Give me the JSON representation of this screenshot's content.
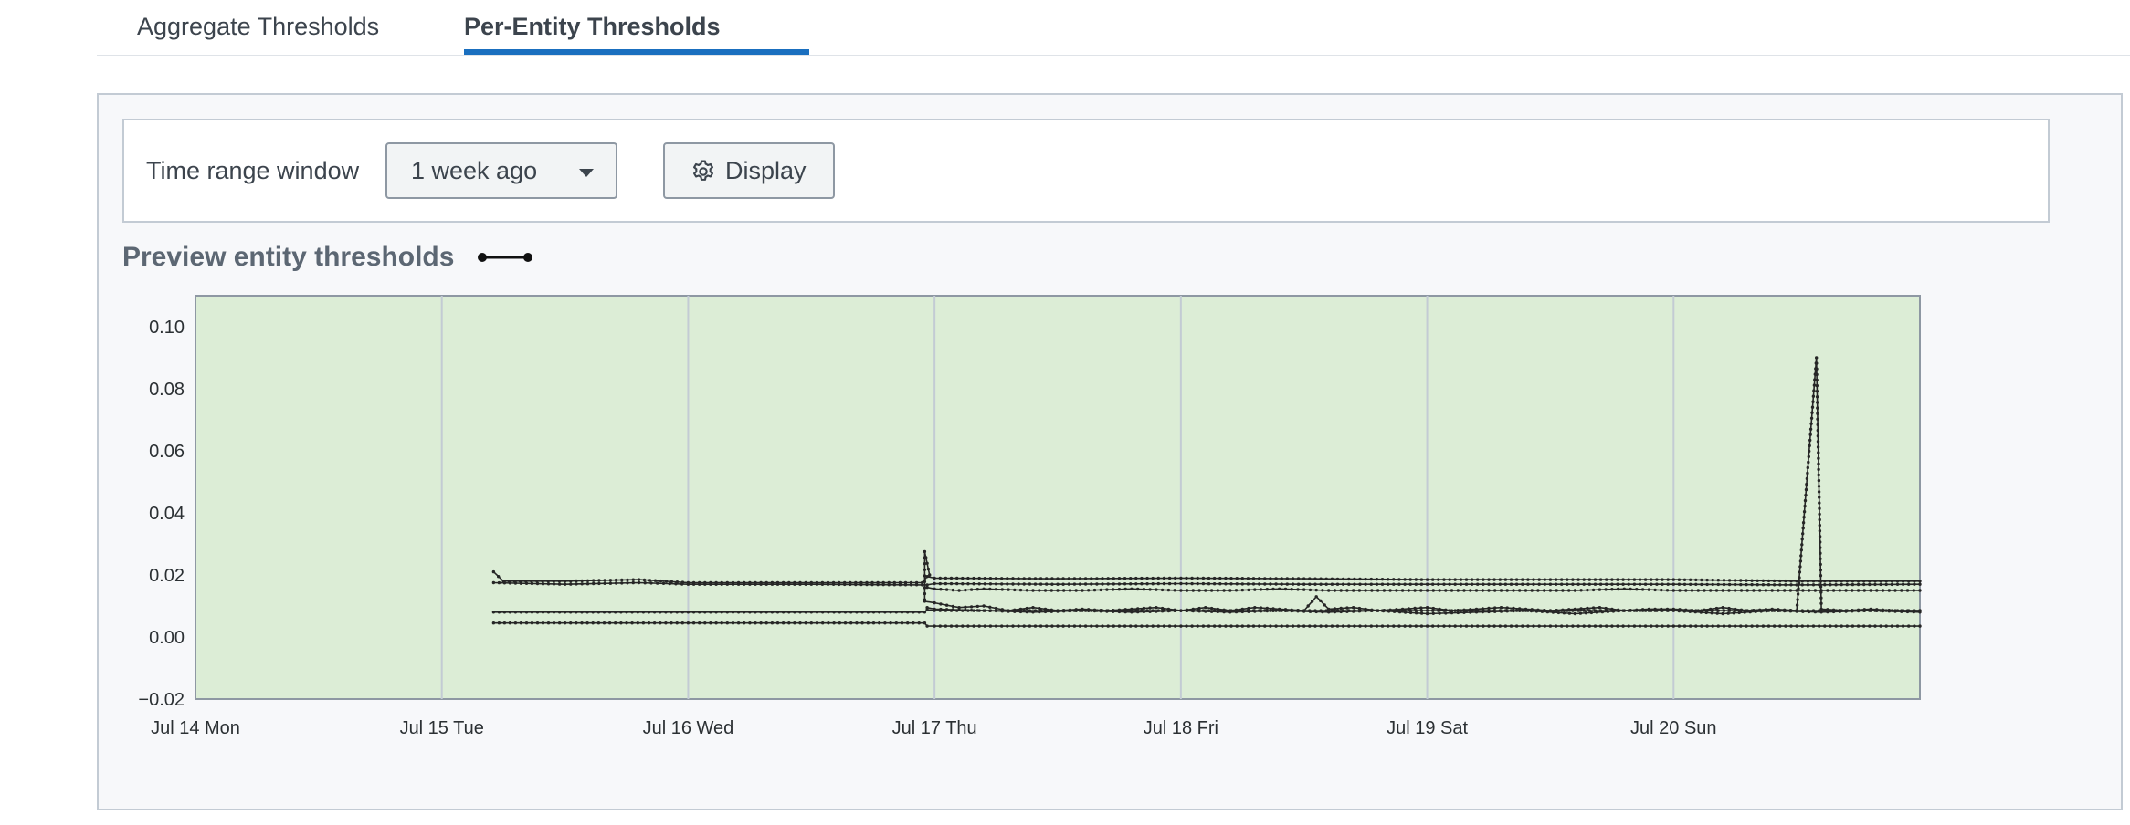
{
  "tabs": [
    {
      "label": "Aggregate Thresholds",
      "selected": false
    },
    {
      "label": "Per-Entity Thresholds",
      "selected": true
    }
  ],
  "toolbar": {
    "time_range_label": "Time range window",
    "time_range_value": "1 week ago",
    "display_label": "Display"
  },
  "preview": {
    "title": "Preview entity thresholds"
  },
  "colors": {
    "accent": "#1a6fbf",
    "plot_background": "#dcedd6",
    "series": "#262626",
    "gridline": "#c3cbd4"
  },
  "chart_data": {
    "type": "line",
    "title": "",
    "xlabel": "",
    "ylabel": "",
    "xlim": [
      0,
      7
    ],
    "ylim": [
      -0.02,
      0.11
    ],
    "x_ticks": [
      {
        "pos": 0,
        "label": "Jul 14 Mon"
      },
      {
        "pos": 1,
        "label": "Jul 15 Tue"
      },
      {
        "pos": 2,
        "label": "Jul 16 Wed"
      },
      {
        "pos": 3,
        "label": "Jul 17 Thu"
      },
      {
        "pos": 4,
        "label": "Jul 18 Fri"
      },
      {
        "pos": 5,
        "label": "Jul 19 Sat"
      },
      {
        "pos": 6,
        "label": "Jul 20 Sun"
      }
    ],
    "y_ticks": [
      {
        "value": 0.1,
        "label": "0.10"
      },
      {
        "value": 0.08,
        "label": "0.08"
      },
      {
        "value": 0.06,
        "label": "0.06"
      },
      {
        "value": 0.04,
        "label": "0.04"
      },
      {
        "value": 0.02,
        "label": "0.02"
      },
      {
        "value": 0.0,
        "label": "0.00"
      },
      {
        "value": -0.02,
        "label": "−0.02"
      }
    ],
    "grid": "vertical",
    "series": [
      {
        "x": [
          1.21,
          1.25,
          1.5,
          1.8,
          2.0,
          2.5,
          2.95,
          2.97,
          3.0,
          3.5,
          4.0,
          4.5,
          5.0,
          5.5,
          6.0,
          6.5,
          7.0
        ],
        "y": [
          0.021,
          0.018,
          0.018,
          0.0185,
          0.0175,
          0.0175,
          0.0175,
          0.0195,
          0.019,
          0.0188,
          0.019,
          0.0188,
          0.0185,
          0.0185,
          0.0185,
          0.018,
          0.018
        ]
      },
      {
        "x": [
          1.21,
          1.5,
          1.8,
          2.0,
          2.5,
          2.95,
          2.97,
          3.0,
          3.5,
          4.0,
          4.5,
          5.0,
          5.5,
          6.0,
          6.5,
          7.0
        ],
        "y": [
          0.0175,
          0.017,
          0.0175,
          0.017,
          0.017,
          0.0168,
          0.0168,
          0.0172,
          0.017,
          0.0172,
          0.017,
          0.017,
          0.017,
          0.017,
          0.0168,
          0.017
        ]
      },
      {
        "x": [
          2.97,
          3.0,
          3.1,
          3.2,
          3.4,
          3.6,
          3.8,
          4.0,
          4.2,
          4.4,
          4.6,
          4.8,
          5.0,
          5.2,
          5.4,
          5.6,
          5.8,
          6.0,
          6.2,
          6.4,
          6.6,
          6.8,
          7.0
        ],
        "y": [
          0.016,
          0.0155,
          0.015,
          0.0155,
          0.015,
          0.015,
          0.0155,
          0.015,
          0.015,
          0.0155,
          0.015,
          0.015,
          0.015,
          0.015,
          0.015,
          0.015,
          0.0155,
          0.015,
          0.015,
          0.015,
          0.015,
          0.015,
          0.015
        ]
      },
      {
        "x": [
          2.96,
          3.0,
          3.1,
          3.2,
          3.3,
          3.4,
          3.5,
          3.6,
          3.7,
          3.8,
          3.9,
          4.0,
          4.1,
          4.2,
          4.3,
          4.4,
          4.5,
          4.55,
          4.6,
          4.7,
          4.8,
          4.9,
          5.0,
          5.1,
          5.2,
          5.3,
          5.4,
          5.5,
          5.6,
          5.7,
          5.8,
          5.9,
          6.0,
          6.1,
          6.2,
          6.3,
          6.4,
          6.5,
          6.58,
          6.6,
          6.7,
          6.8,
          6.9,
          7.0
        ],
        "y": [
          0.0115,
          0.011,
          0.0095,
          0.01,
          0.0085,
          0.0095,
          0.0085,
          0.009,
          0.0085,
          0.009,
          0.0095,
          0.0085,
          0.0095,
          0.0085,
          0.0095,
          0.009,
          0.0085,
          0.013,
          0.009,
          0.0095,
          0.0085,
          0.009,
          0.0095,
          0.0085,
          0.009,
          0.0095,
          0.009,
          0.0085,
          0.009,
          0.0095,
          0.0085,
          0.009,
          0.009,
          0.0085,
          0.0095,
          0.0085,
          0.009,
          0.0085,
          0.09,
          0.009,
          0.0085,
          0.009,
          0.0085,
          0.0085
        ]
      },
      {
        "x": [
          2.97,
          3.0,
          3.2,
          3.4,
          3.6,
          3.8,
          4.0,
          4.2,
          4.4,
          4.6,
          4.8,
          5.0,
          5.2,
          5.4,
          5.6,
          5.8,
          6.0,
          6.2,
          6.4,
          6.6,
          6.8,
          7.0
        ],
        "y": [
          0.0095,
          0.009,
          0.0085,
          0.008,
          0.0085,
          0.008,
          0.0085,
          0.008,
          0.0085,
          0.008,
          0.0085,
          0.0075,
          0.008,
          0.0085,
          0.0075,
          0.0085,
          0.0085,
          0.0075,
          0.0085,
          0.008,
          0.0085,
          0.008
        ]
      },
      {
        "x": [
          1.21,
          1.5,
          2.0,
          2.5,
          2.96,
          2.97,
          3.0,
          3.5,
          4.0,
          4.5,
          5.0,
          5.5,
          6.0,
          6.5,
          7.0
        ],
        "y": [
          0.008,
          0.008,
          0.008,
          0.008,
          0.008,
          0.0088,
          0.0085,
          0.0085,
          0.0085,
          0.0085,
          0.0085,
          0.0085,
          0.0085,
          0.0085,
          0.0085
        ]
      },
      {
        "x": [
          1.21,
          1.5,
          2.0,
          2.5,
          2.96,
          2.97,
          3.0,
          3.5,
          4.0,
          4.5,
          5.0,
          5.5,
          6.0,
          6.5,
          7.0
        ],
        "y": [
          0.0045,
          0.0045,
          0.0045,
          0.0045,
          0.0045,
          0.0035,
          0.0035,
          0.0035,
          0.0035,
          0.0035,
          0.0035,
          0.0035,
          0.0035,
          0.0035,
          0.0035
        ]
      },
      {
        "x": [
          2.96,
          2.96,
          2.98
        ],
        "y": [
          0.012,
          0.0275,
          0.02
        ]
      }
    ]
  }
}
